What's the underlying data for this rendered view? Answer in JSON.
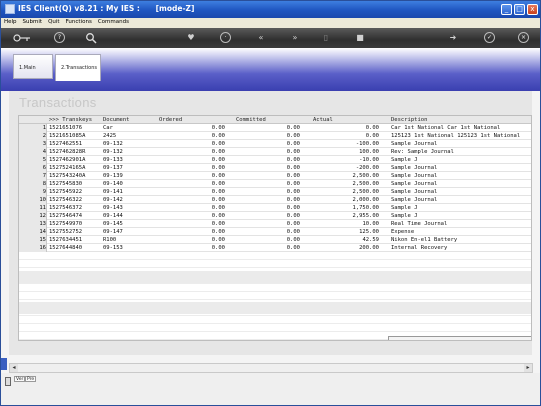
{
  "window": {
    "title": "IES Client(Q) v8.21 : My IES :      [mode-Z]",
    "buttons": [
      "_",
      "□",
      "x"
    ]
  },
  "menu": [
    "Help",
    "Submit",
    "Quit",
    "Functions",
    "Commands"
  ],
  "toolbar": {
    "icons": [
      "key-icon",
      "help-icon",
      "search-icon",
      "heart-icon",
      "clock-icon",
      "rewind-icon",
      "forward-icon",
      "tag-icon",
      "edit-icon",
      "next-icon",
      "check-icon",
      "close-icon"
    ]
  },
  "tabs": [
    {
      "label": "1.Main"
    },
    {
      "label": "2.Transactions"
    }
  ],
  "heading": "Transactions",
  "grid": {
    "headers": [
      ">>> Transkeys",
      "Document",
      "Ordered",
      "Committed",
      "Actual",
      "Description"
    ],
    "rows": [
      {
        "n": "1",
        "key": "1521651076",
        "doc": "Car",
        "ordered": "0.00",
        "committed": "0.00",
        "actual": "0.00",
        "desc": "Car 1st National Car 1st National"
      },
      {
        "n": "2",
        "key": "1521651085A",
        "doc": "2425",
        "ordered": "0.00",
        "committed": "0.00",
        "actual": "0.00",
        "desc": "125123 1st National 125123 1st National"
      },
      {
        "n": "3",
        "key": "1527462551",
        "doc": "09-132",
        "ordered": "0.00",
        "committed": "0.00",
        "actual": "-100.00",
        "desc": "Sample Journal"
      },
      {
        "n": "4",
        "key": "1527462828R",
        "doc": "09-132",
        "ordered": "0.00",
        "committed": "0.00",
        "actual": "100.00",
        "desc": "Rev: Sample Journal"
      },
      {
        "n": "5",
        "key": "1527462901A",
        "doc": "09-133",
        "ordered": "0.00",
        "committed": "0.00",
        "actual": "-10.00",
        "desc": "Sample J"
      },
      {
        "n": "6",
        "key": "1527524165A",
        "doc": "09-137",
        "ordered": "0.00",
        "committed": "0.00",
        "actual": "-200.00",
        "desc": "Sample Journal"
      },
      {
        "n": "7",
        "key": "1527543240A",
        "doc": "09-139",
        "ordered": "0.00",
        "committed": "0.00",
        "actual": "2,500.00",
        "desc": "Sample Journal"
      },
      {
        "n": "8",
        "key": "1527545830",
        "doc": "09-140",
        "ordered": "0.00",
        "committed": "0.00",
        "actual": "2,500.00",
        "desc": "Sample Journal"
      },
      {
        "n": "9",
        "key": "1527545922",
        "doc": "09-141",
        "ordered": "0.00",
        "committed": "0.00",
        "actual": "2,500.00",
        "desc": "Sample Journal"
      },
      {
        "n": "10",
        "key": "1527546322",
        "doc": "09-142",
        "ordered": "0.00",
        "committed": "0.00",
        "actual": "2,000.00",
        "desc": "Sample Journal"
      },
      {
        "n": "11",
        "key": "1527546372",
        "doc": "09-143",
        "ordered": "0.00",
        "committed": "0.00",
        "actual": "1,750.00",
        "desc": "Sample J"
      },
      {
        "n": "12",
        "key": "1527546474",
        "doc": "09-144",
        "ordered": "0.00",
        "committed": "0.00",
        "actual": "2,955.00",
        "desc": "Sample J"
      },
      {
        "n": "13",
        "key": "1527549970",
        "doc": "09-145",
        "ordered": "0.00",
        "committed": "0.00",
        "actual": "10.00",
        "desc": "Real Time Journal"
      },
      {
        "n": "14",
        "key": "1527552752",
        "doc": "09-147",
        "ordered": "0.00",
        "committed": "0.00",
        "actual": "125.00",
        "desc": "Expense"
      },
      {
        "n": "15",
        "key": "1527634451",
        "doc": "R100",
        "ordered": "0.00",
        "committed": "0.00",
        "actual": "42.59",
        "desc": "Nikon En-el1 Battery"
      },
      {
        "n": "16",
        "key": "1527644840",
        "doc": "09-153",
        "ordered": "0.00",
        "committed": "0.00",
        "actual": "200.00",
        "desc": "Internal Recovery"
      }
    ]
  },
  "bottom": {
    "buttons": [
      "Ver",
      "Pre"
    ]
  },
  "colors": {
    "titlebar": "#1f55c0",
    "tabband": "#3a3fb0",
    "heading": "#c7c7c7"
  }
}
